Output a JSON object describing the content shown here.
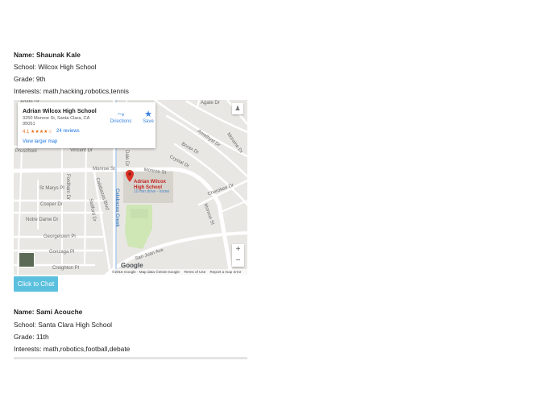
{
  "students": [
    {
      "name_label": "Name:",
      "name": "Shaunak Kale",
      "school_line": "School: Wilcox High School",
      "grade_line": "Grade: 9th",
      "interests_line": "Interests: math,hacking,robotics,tennis"
    },
    {
      "name_label": "Name:",
      "name": "Sami Acouche",
      "school_line": "School: Santa Clara High School",
      "grade_line": "Grade: 11th",
      "interests_line": "Interests: math,robotics,football,debate"
    }
  ],
  "map": {
    "card": {
      "place_name": "Adrian Wilcox High School",
      "address": "3250 Monroe St, Santa Clara, CA 95051",
      "rating": "4.1",
      "stars": "★★★★☆",
      "reviews": "24 reviews",
      "directions_label": "Directions",
      "save_label": "Save",
      "view_larger": "View larger map"
    },
    "marker_name_line1": "Adrian Wilcox",
    "marker_name_line2": "High School",
    "marker_drive": "10 min drive - home",
    "road_labels": {
      "agate_dr": "Agate Dr",
      "agate_dr2": "Agate Dr",
      "amethyst_dr": "Amethyst Dr",
      "bolero_dr": "Borax Dr",
      "crystal_dr": "Crystal Dr",
      "moraine_dr": "Moraine Dr",
      "vincent_dr": "Vincent Dr",
      "monroe_st": "Monroe St",
      "monroe_st2": "Monroe St",
      "monroe_st3": "Monroe St",
      "st_marys": "St Marys Pl",
      "cooper_dr": "Cooper Dr",
      "notre_dame": "Notre Dame Dr",
      "georgetown": "Georgetown Pl",
      "gonzaga": "Gonzaga Pl",
      "creighton": "Creighton Pl",
      "san_juan": "San Juan Ave",
      "cherokee": "Cherokee Dr",
      "preschool": "Preschool",
      "fordham": "Fordham Dr",
      "calabazas_blvd": "Calabazas Blvd",
      "stafford": "Stafford Dr",
      "calabazas_creek": "Calabazas Creek",
      "dale_dr": "Dale Dr"
    },
    "zoom_in": "+",
    "zoom_out": "−",
    "google_logo": "Google",
    "attribution": "©2016 Google · Map data ©2016 Google",
    "terms": "Terms of Use",
    "report": "Report a map error"
  },
  "chat_button_label": "Click to Chat",
  "colors": {
    "chat_button": "#5bc0de",
    "link": "#1a73e8",
    "marker": "#d93025",
    "creek": "#4a86c5"
  }
}
